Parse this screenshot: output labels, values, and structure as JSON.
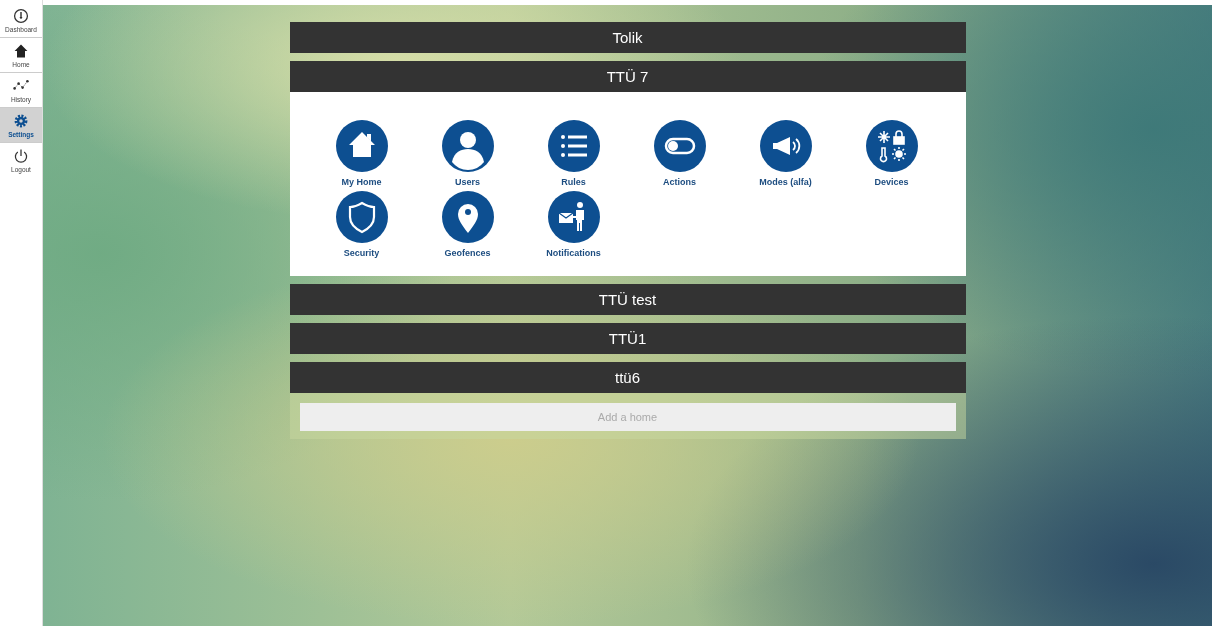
{
  "sidebar": {
    "items": [
      {
        "label": "Dashboard",
        "kind": "dashboard",
        "selected": false
      },
      {
        "label": "Home",
        "kind": "home",
        "selected": false
      },
      {
        "label": "History",
        "kind": "history",
        "selected": false
      },
      {
        "label": "Settings",
        "kind": "settings",
        "selected": true
      },
      {
        "label": "Logout",
        "kind": "logout",
        "selected": false
      }
    ]
  },
  "homes": [
    {
      "name": "Tolik",
      "expanded": false
    },
    {
      "name": "TTÜ 7",
      "expanded": true,
      "settings": [
        {
          "label": "My Home",
          "kind": "home"
        },
        {
          "label": "Users",
          "kind": "user"
        },
        {
          "label": "Rules",
          "kind": "list"
        },
        {
          "label": "Actions",
          "kind": "toggle"
        },
        {
          "label": "Modes (alfa)",
          "kind": "megaphone"
        },
        {
          "label": "Devices",
          "kind": "devices"
        },
        {
          "label": "Security",
          "kind": "shield"
        },
        {
          "label": "Geofences",
          "kind": "pin"
        },
        {
          "label": "Notifications",
          "kind": "mail"
        }
      ]
    },
    {
      "name": "TTÜ test",
      "expanded": false
    },
    {
      "name": "TTÜ1",
      "expanded": false
    },
    {
      "name": "ttü6",
      "expanded": false
    }
  ],
  "add_home": {
    "label": "Add a home"
  }
}
